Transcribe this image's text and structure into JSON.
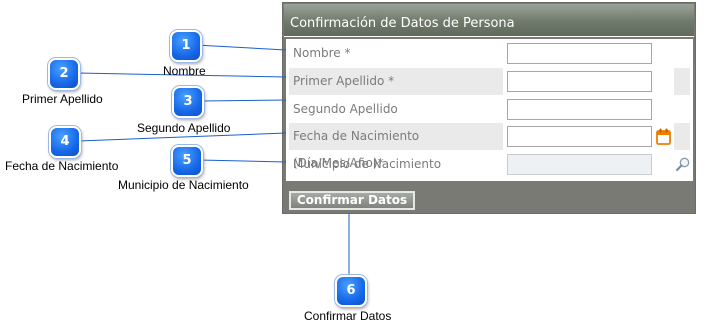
{
  "form": {
    "title": "Confirmación de Datos de Persona",
    "fields": [
      {
        "label": "Nombre *",
        "value": ""
      },
      {
        "label": "Primer Apellido *",
        "value": ""
      },
      {
        "label": "Segundo Apellido",
        "value": ""
      },
      {
        "label": "Fecha de Nacimiento (Día/Mes/Año)*",
        "value": ""
      },
      {
        "label": "Municipio de Nacimiento",
        "value": ""
      }
    ],
    "confirm_button": "Confirmar Datos",
    "icons": {
      "date": "calendar-icon",
      "lookup": "search-icon"
    }
  },
  "callouts": [
    {
      "number": "1",
      "label": "Nombre"
    },
    {
      "number": "2",
      "label": "Primer Apellido"
    },
    {
      "number": "3",
      "label": "Segundo Apellido"
    },
    {
      "number": "4",
      "label": "Fecha de Nacimiento"
    },
    {
      "number": "5",
      "label": "Municipio de Nacimiento"
    },
    {
      "number": "6",
      "label": "Confirmar Datos"
    }
  ],
  "colors": {
    "badge": "#1668e8",
    "panel_header": "#6f7a6b",
    "calendar_icon": "#f07e00"
  }
}
